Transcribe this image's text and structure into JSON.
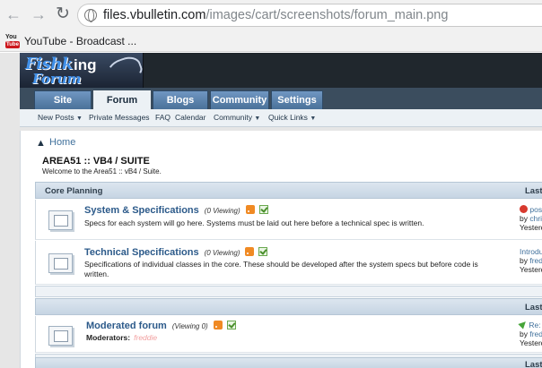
{
  "browser": {
    "url_host": "files.vbulletin.com",
    "url_path": "/images/cart/screenshots/forum_main.png",
    "bookmark_label": "YouTube - Broadcast ..."
  },
  "site": {
    "logo_fish": "Fishk",
    "logo_ing": "ing",
    "logo_forum": "Forum",
    "tabs": [
      "Site",
      "Forum",
      "Blogs",
      "Community",
      "Settings"
    ],
    "subnav": {
      "new_posts": "New Posts",
      "private_messages": "Private Messages",
      "faq": "FAQ",
      "calendar": "Calendar",
      "community": "Community",
      "quick_links": "Quick Links"
    }
  },
  "breadcrumb": {
    "home": "Home"
  },
  "page": {
    "title": "AREA51 :: VB4 / SUITE",
    "subtitle": "Welcome to the Area51 :: vB4 / Suite."
  },
  "categories": {
    "core_planning": "Core Planning",
    "last_post": "Last Post"
  },
  "forums": [
    {
      "title": "System & Specifications",
      "viewing": "(0 Viewing)",
      "description": "Specs for each system will go here. Systems must be laid out here before a technical spec is written.",
      "last_title": "posting",
      "last_by": "by",
      "last_user": "chris",
      "last_time": "Yesterday"
    },
    {
      "title": "Technical Specifications",
      "viewing": "(0 Viewing)",
      "description": "Specifications of individual classes in the core. These should be developed after the system specs but before code is written.",
      "last_title": "Introductio",
      "last_by": "by",
      "last_user": "freddie",
      "last_time": "Yesterday"
    },
    {
      "title": "Moderated forum",
      "viewing": "(Viewing 0)",
      "moderators_label": "Moderators:",
      "moderator": "freddie",
      "last_title": "Re: Ya",
      "last_by": "by",
      "last_user": "freddie",
      "last_time": "Yesterday"
    }
  ],
  "colors": {
    "header_bg": "#20272d",
    "tab_blue": "#4a7199",
    "link_blue": "#41719c",
    "forum_title": "#2c5a8a",
    "moderator_pink": "#f2a0a0"
  }
}
